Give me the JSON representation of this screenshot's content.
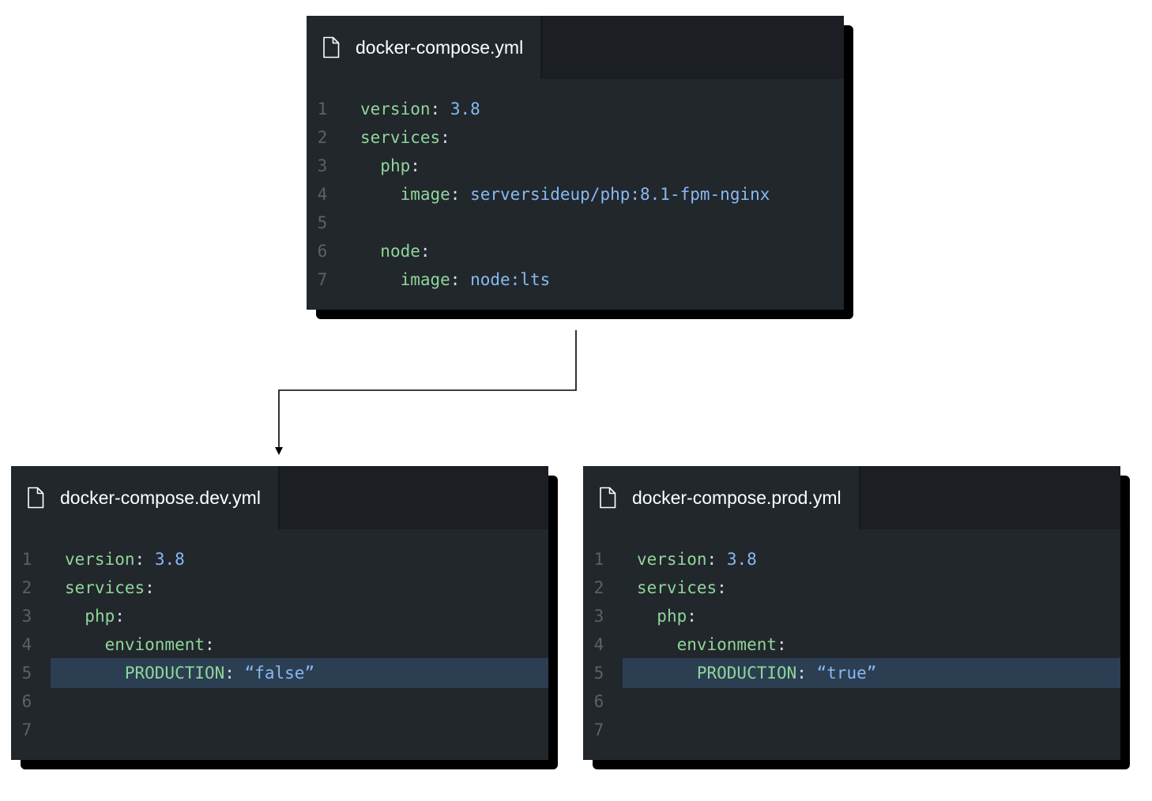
{
  "colors": {
    "panel_bg": "#22272c",
    "tabbar_bg": "#1b1f24",
    "key": "#8fd69a",
    "value": "#87b9f2",
    "line_number": "#5b6168",
    "highlight": "#2c3e52"
  },
  "files": [
    {
      "filename": "docker-compose.yml",
      "icon": "file-icon",
      "lines": [
        {
          "num": "1",
          "indent": "",
          "key": "version",
          "sep": ": ",
          "value": "3.8",
          "highlight": false
        },
        {
          "num": "2",
          "indent": "",
          "key": "services",
          "sep": ":",
          "value": "",
          "highlight": false
        },
        {
          "num": "3",
          "indent": "  ",
          "key": "php",
          "sep": ":",
          "value": "",
          "highlight": false
        },
        {
          "num": "4",
          "indent": "    ",
          "key": "image",
          "sep": ": ",
          "value": "serversideup/php:8.1-fpm-nginx",
          "highlight": false
        },
        {
          "num": "5",
          "indent": "",
          "key": "",
          "sep": "",
          "value": "",
          "highlight": false
        },
        {
          "num": "6",
          "indent": "  ",
          "key": "node",
          "sep": ":",
          "value": "",
          "highlight": false
        },
        {
          "num": "7",
          "indent": "    ",
          "key": "image",
          "sep": ": ",
          "value": "node:lts",
          "highlight": false
        }
      ]
    },
    {
      "filename": "docker-compose.dev.yml",
      "icon": "file-icon",
      "lines": [
        {
          "num": "1",
          "indent": "",
          "key": "version",
          "sep": ": ",
          "value": "3.8",
          "highlight": false
        },
        {
          "num": "2",
          "indent": "",
          "key": "services",
          "sep": ":",
          "value": "",
          "highlight": false
        },
        {
          "num": "3",
          "indent": "  ",
          "key": "php",
          "sep": ":",
          "value": "",
          "highlight": false
        },
        {
          "num": "4",
          "indent": "    ",
          "key": "envionment",
          "sep": ":",
          "value": "",
          "highlight": false
        },
        {
          "num": "5",
          "indent": "      ",
          "key": "PRODUCTION",
          "sep": ": ",
          "value": "“false”",
          "highlight": true
        },
        {
          "num": "6",
          "indent": "",
          "key": "",
          "sep": "",
          "value": "",
          "highlight": false
        },
        {
          "num": "7",
          "indent": "",
          "key": "",
          "sep": "",
          "value": "",
          "highlight": false
        }
      ]
    },
    {
      "filename": "docker-compose.prod.yml",
      "icon": "file-icon",
      "lines": [
        {
          "num": "1",
          "indent": "",
          "key": "version",
          "sep": ": ",
          "value": "3.8",
          "highlight": false
        },
        {
          "num": "2",
          "indent": "",
          "key": "services",
          "sep": ":",
          "value": "",
          "highlight": false
        },
        {
          "num": "3",
          "indent": "  ",
          "key": "php",
          "sep": ":",
          "value": "",
          "highlight": false
        },
        {
          "num": "4",
          "indent": "    ",
          "key": "envionment",
          "sep": ":",
          "value": "",
          "highlight": false
        },
        {
          "num": "5",
          "indent": "      ",
          "key": "PRODUCTION",
          "sep": ": ",
          "value": "“true”",
          "highlight": true
        },
        {
          "num": "6",
          "indent": "",
          "key": "",
          "sep": "",
          "value": "",
          "highlight": false
        },
        {
          "num": "7",
          "indent": "",
          "key": "",
          "sep": "",
          "value": "",
          "highlight": false
        }
      ]
    }
  ]
}
